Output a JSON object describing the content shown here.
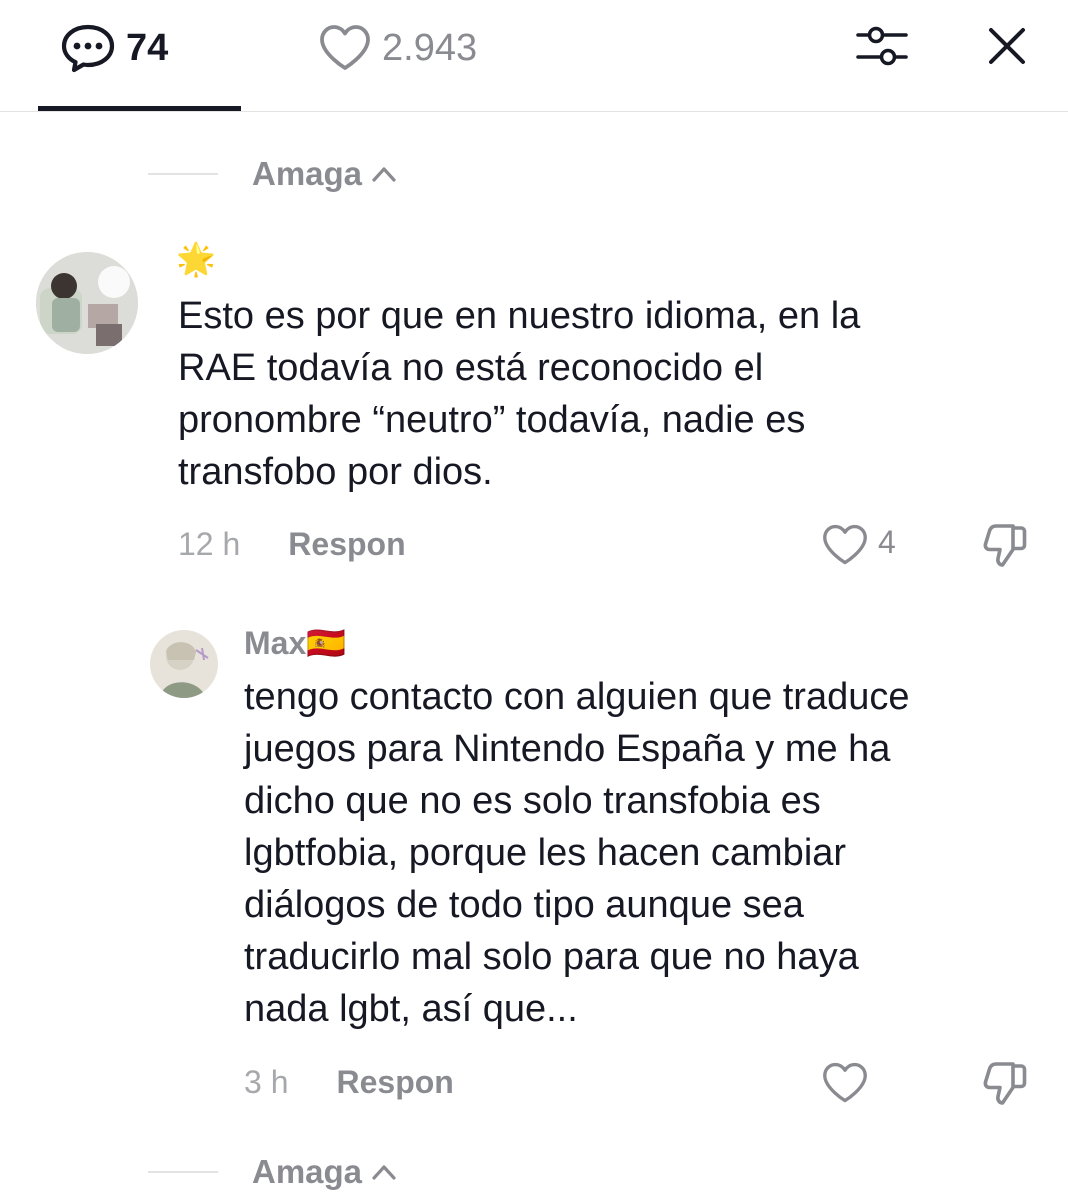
{
  "header": {
    "comments_count": "74",
    "likes_count": "2.943",
    "active_tab": "comments"
  },
  "hide_replies": {
    "label": "Amaga"
  },
  "comments": [
    {
      "username": "🌟",
      "text_lines": [
        "Esto es por que en nuestro idioma, en la",
        "RAE todavía no está reconocido el",
        "pronombre “neutro” todavía, nadie es",
        "transfobo por dios."
      ],
      "time": "12 h",
      "reply_label": "Respon",
      "likes": "4"
    },
    {
      "username": "Max🇪🇸",
      "text_lines": [
        "tengo contacto con alguien que traduce",
        "juegos para Nintendo España y me ha",
        "dicho que no es solo transfobia es",
        "lgbtfobia, porque les hacen cambiar",
        "diálogos de todo tipo aunque sea",
        "traducirlo mal solo para que no haya",
        "nada lgbt, así que..."
      ],
      "time": "3 h",
      "reply_label": "Respon",
      "likes": ""
    }
  ],
  "colors": {
    "text_primary": "#161823",
    "text_secondary": "#8a8b91",
    "divider": "#e3e3e4"
  },
  "icons": {
    "comments": "speech-bubble-icon",
    "likes": "heart-outline-icon",
    "filter": "sliders-icon",
    "close": "close-icon",
    "dislike": "thumbs-down-icon"
  }
}
